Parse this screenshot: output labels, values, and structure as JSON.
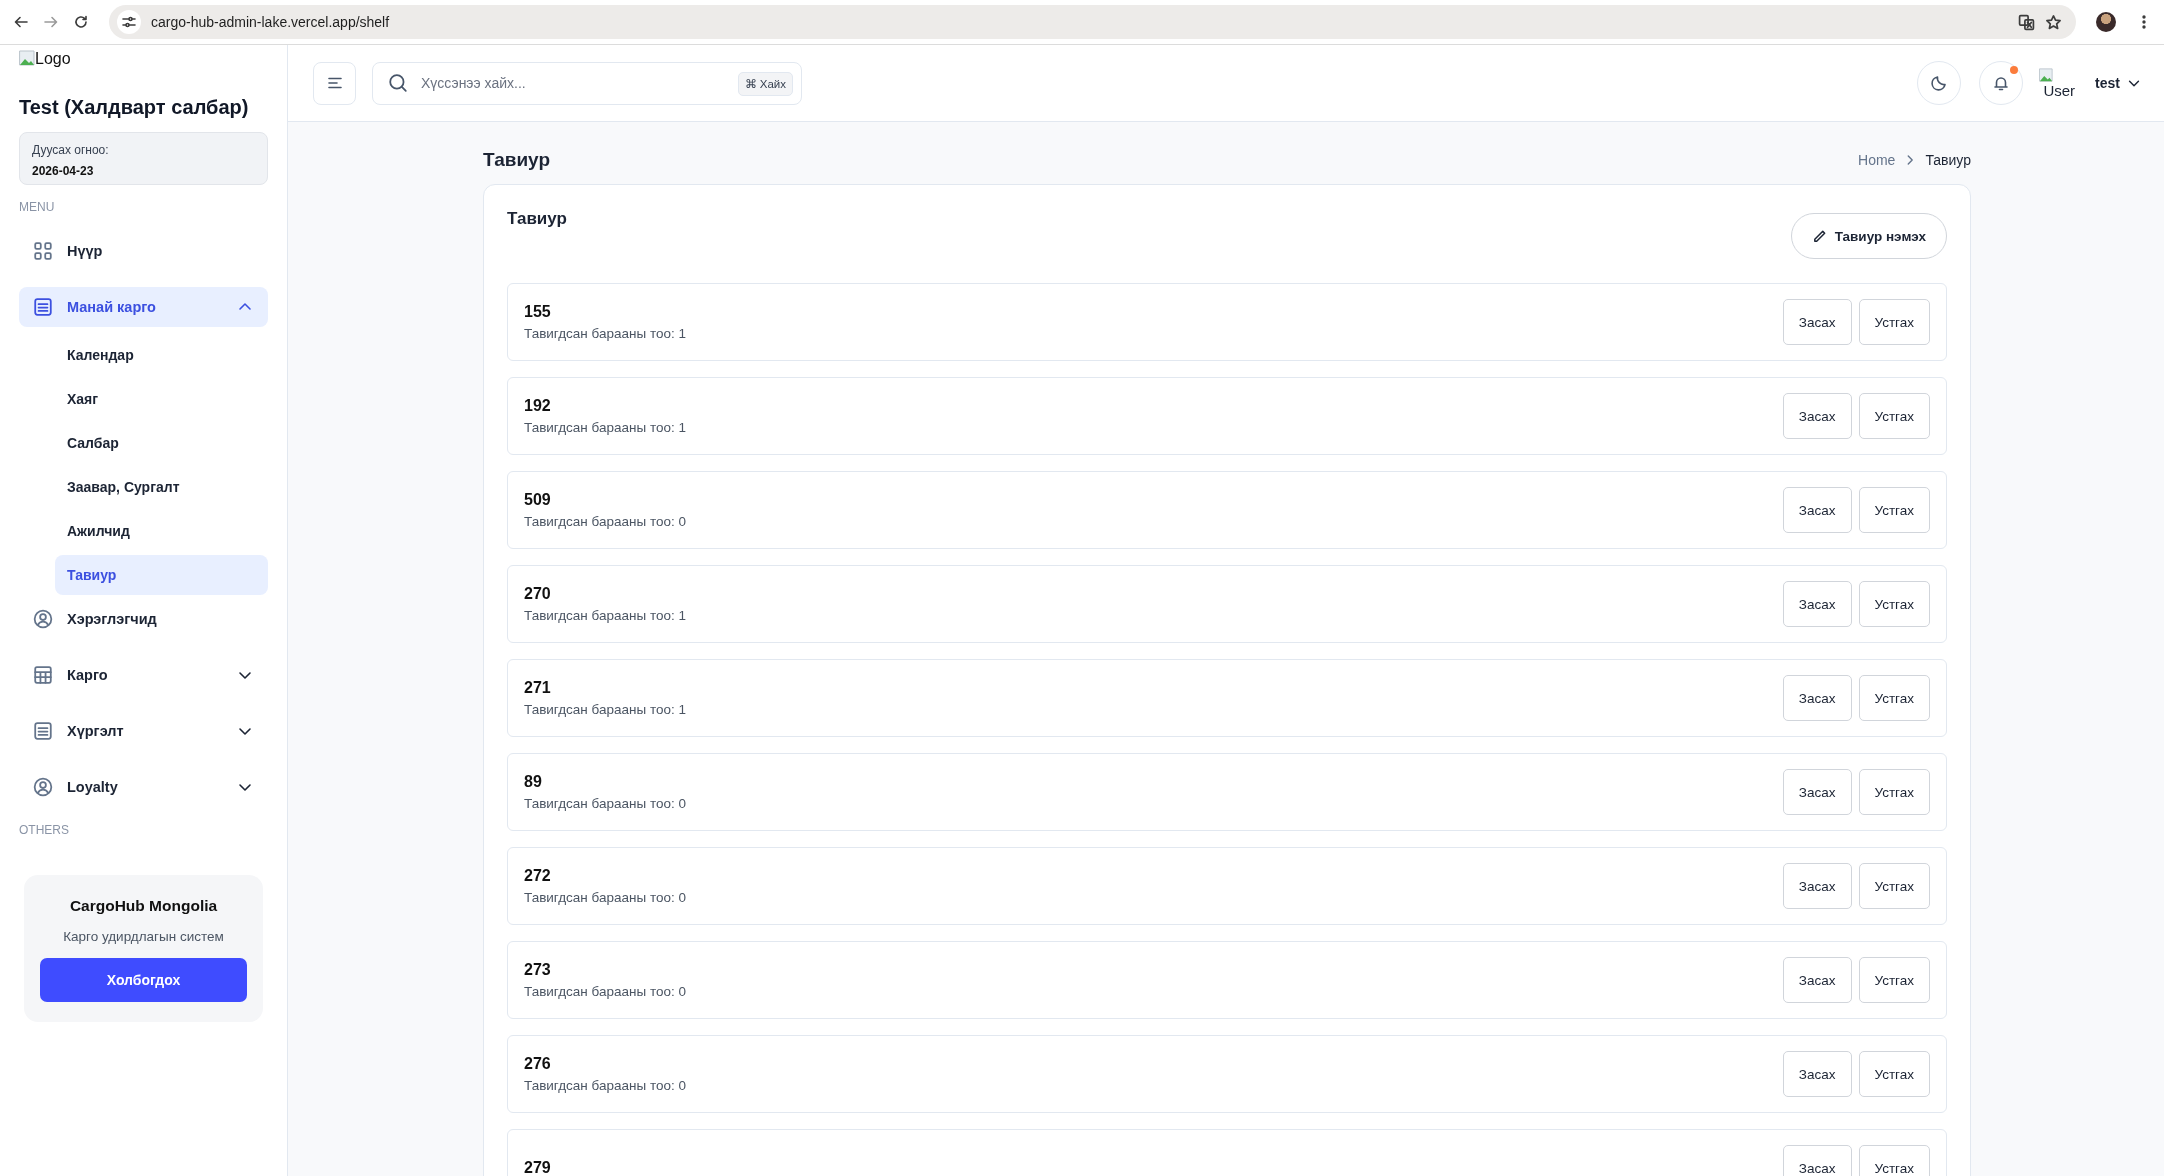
{
  "browser": {
    "url": "cargo-hub-admin-lake.vercel.app/shelf"
  },
  "sidebar": {
    "logo_alt": "Logo",
    "title": "Test (Халдварт салбар)",
    "expiry": {
      "label": "Дуусах огноо:",
      "value": "2026-04-23"
    },
    "sections": [
      {
        "heading": "MENU",
        "items": [
          {
            "label": "Нүүр",
            "kind": "link",
            "selected": false
          },
          {
            "label": "Манай карго",
            "kind": "group",
            "selected": true,
            "expanded": true,
            "children": [
              {
                "label": "Календар",
                "selected": false
              },
              {
                "label": "Хаяг",
                "selected": false
              },
              {
                "label": "Салбар",
                "selected": false
              },
              {
                "label": "Заавар, Сургалт",
                "selected": false
              },
              {
                "label": "Ажилчид",
                "selected": false
              },
              {
                "label": "Тавиур",
                "selected": true
              }
            ]
          },
          {
            "label": "Хэрэглэгчид",
            "kind": "link",
            "selected": false
          },
          {
            "label": "Карго",
            "kind": "group",
            "selected": false,
            "expanded": false
          },
          {
            "label": "Хүргэлт",
            "kind": "group",
            "selected": false,
            "expanded": false
          },
          {
            "label": "Loyalty",
            "kind": "group",
            "selected": false,
            "expanded": false
          }
        ]
      },
      {
        "heading": "OTHERS"
      }
    ],
    "promo": {
      "title": "CargoHub Mongolia",
      "subtitle": "Карго удирдлагын систем",
      "button": "Холбогдох"
    }
  },
  "header": {
    "search": {
      "placeholder": "Хүссэнээ хайх...",
      "shortcut": "⌘ Хайх"
    },
    "notifications_unread": true,
    "avatar_alt": "User",
    "user_name": "test"
  },
  "page": {
    "title": "Тавиур",
    "breadcrumb": [
      "Home",
      "Тавиур"
    ],
    "card": {
      "title": "Тавиур",
      "add_button": "Тавиур нэмэх",
      "rows": [
        {
          "number": "155",
          "caption": "Тавигдсан барааны тоо: 1",
          "actions": [
            "Засах",
            "Устгах"
          ]
        },
        {
          "number": "192",
          "caption": "Тавигдсан барааны тоо: 1",
          "actions": [
            "Засах",
            "Устгах"
          ]
        },
        {
          "number": "509",
          "caption": "Тавигдсан барааны тоо: 0",
          "actions": [
            "Засах",
            "Устгах"
          ]
        },
        {
          "number": "270",
          "caption": "Тавигдсан барааны тоо: 1",
          "actions": [
            "Засах",
            "Устгах"
          ]
        },
        {
          "number": "271",
          "caption": "Тавигдсан барааны тоо: 1",
          "actions": [
            "Засах",
            "Устгах"
          ]
        },
        {
          "number": "89",
          "caption": "Тавигдсан барааны тоо: 0",
          "actions": [
            "Засах",
            "Устгах"
          ]
        },
        {
          "number": "272",
          "caption": "Тавигдсан барааны тоо: 0",
          "actions": [
            "Засах",
            "Устгах"
          ]
        },
        {
          "number": "273",
          "caption": "Тавигдсан барааны тоо: 0",
          "actions": [
            "Засах",
            "Устгах"
          ]
        },
        {
          "number": "276",
          "caption": "Тавигдсан барааны тоо: 0",
          "actions": [
            "Засах",
            "Устгах"
          ]
        },
        {
          "number": "279",
          "actions": [
            "Засах",
            "Устгах"
          ]
        }
      ]
    }
  }
}
